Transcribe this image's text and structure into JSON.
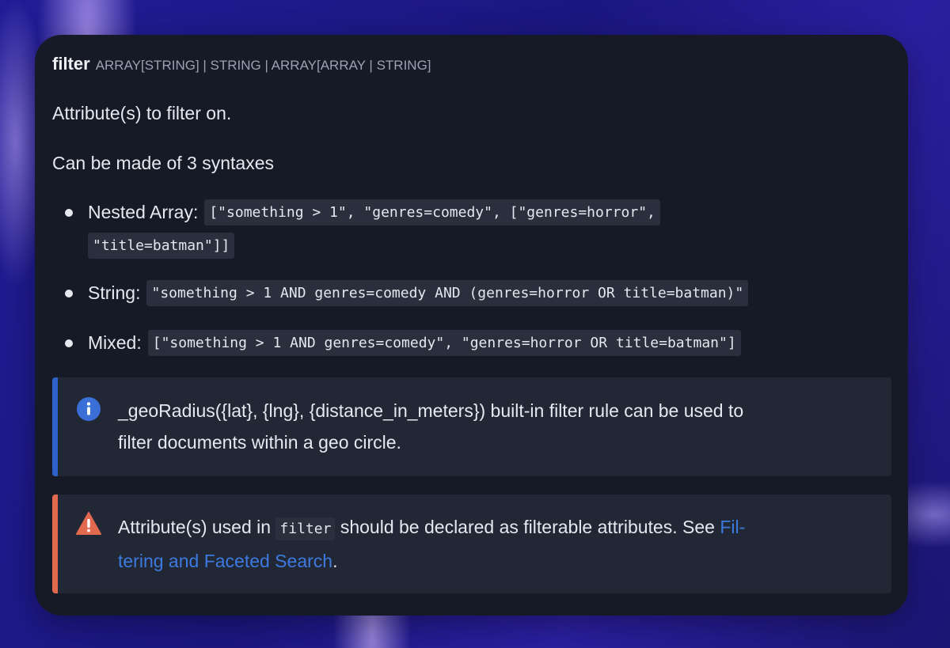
{
  "header": {
    "title": "filter",
    "types": "ARRAY[STRING] | STRING | ARRAY[ARRAY | STRING]"
  },
  "description": "Attribute(s) to filter on.",
  "syntaxes_intro": "Can be made of 3 syntaxes",
  "syntaxes": [
    {
      "label": "Nested Array:",
      "code_line1": "[\"something > 1\", \"genres=comedy\", [\"genres=horror\",",
      "code_line2": "\"title=batman\"]]"
    },
    {
      "label": "String:",
      "code": "\"something > 1 AND genres=comedy AND (genres=horror OR title=batman)\""
    },
    {
      "label": "Mixed:",
      "code": "[\"something > 1 AND genres=comedy\", \"genres=horror OR title=batman\"]"
    }
  ],
  "info_callout": {
    "icon": "info-icon",
    "line1": "_geoRadius({lat}, {lng}, {distance_in_meters}) built-in filter rule can be used to",
    "line2": "filter documents within a geo circle.",
    "accent": "#2d63c8"
  },
  "warning_callout": {
    "icon": "warning-icon",
    "text_before": "Attribute(s) used in",
    "code": "filter",
    "text_after": "should be declared as filterable attributes. See",
    "link_part1": "Fil-",
    "link_part2": "tering and Faceted Search",
    "trailing": ".",
    "accent": "#e0694e"
  },
  "colors": {
    "card_bg": "#161a27",
    "callout_bg": "#222735",
    "link": "#3d7ae0"
  }
}
